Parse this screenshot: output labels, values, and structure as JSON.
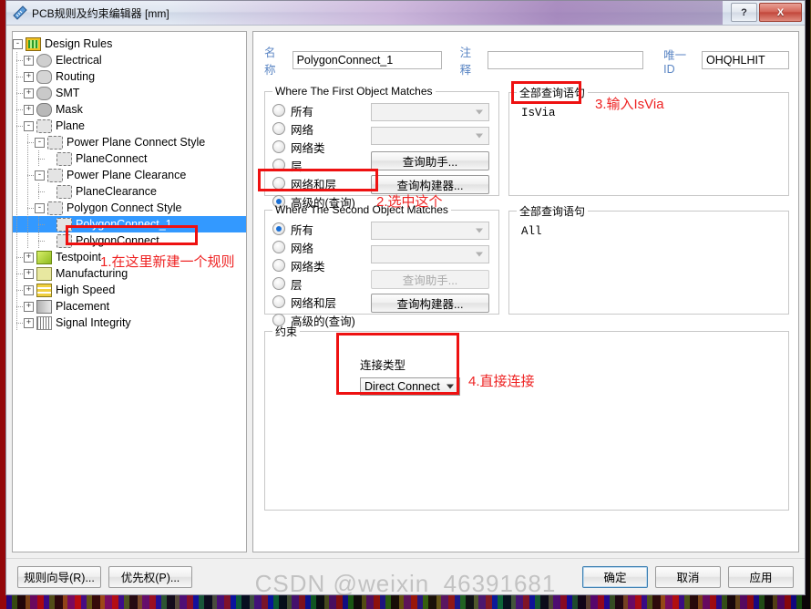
{
  "window": {
    "title": "PCB规则及约束编辑器 [mm]",
    "icon": "ruler-icon",
    "help_button": "?",
    "close_button": "X"
  },
  "tree": {
    "items": [
      {
        "label": "Design Rules",
        "depth": 0,
        "expander": "-",
        "icon": "design-rules-icon",
        "icon_class": "ic-rules",
        "selected": false
      },
      {
        "label": "Electrical",
        "depth": 1,
        "expander": "+",
        "icon": "electrical-icon",
        "icon_class": "ic-elec",
        "selected": false
      },
      {
        "label": "Routing",
        "depth": 1,
        "expander": "+",
        "icon": "routing-icon",
        "icon_class": "ic-route",
        "selected": false
      },
      {
        "label": "SMT",
        "depth": 1,
        "expander": "+",
        "icon": "smt-icon",
        "icon_class": "ic-smt",
        "selected": false
      },
      {
        "label": "Mask",
        "depth": 1,
        "expander": "+",
        "icon": "mask-icon",
        "icon_class": "ic-mask",
        "selected": false
      },
      {
        "label": "Plane",
        "depth": 1,
        "expander": "-",
        "icon": "plane-icon",
        "icon_class": "ic-plane",
        "selected": false
      },
      {
        "label": "Power Plane Connect Style",
        "depth": 2,
        "expander": "-",
        "icon": "plane-icon",
        "icon_class": "ic-plane",
        "selected": false
      },
      {
        "label": "PlaneConnect",
        "depth": 3,
        "expander": "",
        "icon": "plane-icon",
        "icon_class": "ic-plane",
        "selected": false
      },
      {
        "label": "Power Plane Clearance",
        "depth": 2,
        "expander": "-",
        "icon": "plane-icon",
        "icon_class": "ic-plane",
        "selected": false
      },
      {
        "label": "PlaneClearance",
        "depth": 3,
        "expander": "",
        "icon": "plane-icon",
        "icon_class": "ic-plane",
        "selected": false
      },
      {
        "label": "Polygon Connect Style",
        "depth": 2,
        "expander": "-",
        "icon": "plane-icon",
        "icon_class": "ic-plane",
        "selected": false
      },
      {
        "label": "PolygonConnect_1",
        "depth": 3,
        "expander": "",
        "icon": "plane-icon",
        "icon_class": "ic-plane",
        "selected": true
      },
      {
        "label": "PolygonConnect",
        "depth": 3,
        "expander": "",
        "icon": "plane-icon",
        "icon_class": "ic-plane",
        "selected": false
      },
      {
        "label": "Testpoint",
        "depth": 1,
        "expander": "+",
        "icon": "testpoint-icon",
        "icon_class": "ic-test",
        "selected": false
      },
      {
        "label": "Manufacturing",
        "depth": 1,
        "expander": "+",
        "icon": "manufacturing-icon",
        "icon_class": "ic-manu",
        "selected": false
      },
      {
        "label": "High Speed",
        "depth": 1,
        "expander": "+",
        "icon": "high-speed-icon",
        "icon_class": "ic-hs",
        "selected": false
      },
      {
        "label": "Placement",
        "depth": 1,
        "expander": "+",
        "icon": "placement-icon",
        "icon_class": "ic-place",
        "selected": false
      },
      {
        "label": "Signal Integrity",
        "depth": 1,
        "expander": "+",
        "icon": "signal-integrity-icon",
        "icon_class": "ic-sig",
        "selected": false
      }
    ]
  },
  "form": {
    "name_label": "名称",
    "name_value": "PolygonConnect_1",
    "comment_label": "注释",
    "comment_value": "",
    "unique_id_label": "唯一ID",
    "unique_id_value": "OHQHLHIT"
  },
  "first_object": {
    "legend": "Where The First Object Matches",
    "options": [
      {
        "label": "所有",
        "selected": false
      },
      {
        "label": "网络",
        "selected": false
      },
      {
        "label": "网络类",
        "selected": false
      },
      {
        "label": "层",
        "selected": false
      },
      {
        "label": "网络和层",
        "selected": false
      },
      {
        "label": "高级的(查询)",
        "selected": true
      }
    ],
    "net_combo_value": "",
    "netclass_combo_value": "",
    "query_helper_button": "查询助手...",
    "query_builder_button": "查询构建器...",
    "query_legend": "全部查询语句",
    "query_value": "IsVia"
  },
  "second_object": {
    "legend": "Where The Second Object Matches",
    "options": [
      {
        "label": "所有",
        "selected": true
      },
      {
        "label": "网络",
        "selected": false
      },
      {
        "label": "网络类",
        "selected": false
      },
      {
        "label": "层",
        "selected": false
      },
      {
        "label": "网络和层",
        "selected": false
      },
      {
        "label": "高级的(查询)",
        "selected": false
      }
    ],
    "net_combo_value": "",
    "netclass_combo_value": "",
    "query_helper_button": "查询助手...",
    "query_builder_button": "查询构建器...",
    "query_legend": "全部查询语句",
    "query_value": "All"
  },
  "constraint": {
    "legend": "约束",
    "connect_style_label": "连接类型",
    "connect_style_value": "Direct Connect"
  },
  "footer": {
    "rule_wizard_button": "规则向导(R)...",
    "priority_button": "优先权(P)...",
    "ok_button": "确定",
    "cancel_button": "取消",
    "apply_button": "应用"
  },
  "annotations": [
    {
      "id": "a1",
      "text": "1.在这里新建一个规则"
    },
    {
      "id": "a2",
      "text": "2.选中这个"
    },
    {
      "id": "a3",
      "text": "3.输入IsVia"
    },
    {
      "id": "a4",
      "text": "4.直接连接"
    }
  ],
  "watermark": "CSDN @weixin_46391681",
  "colors": {
    "annotation_red": "#ee2222",
    "selection_blue": "#3399ff",
    "label_blue": "#5b86c4"
  }
}
